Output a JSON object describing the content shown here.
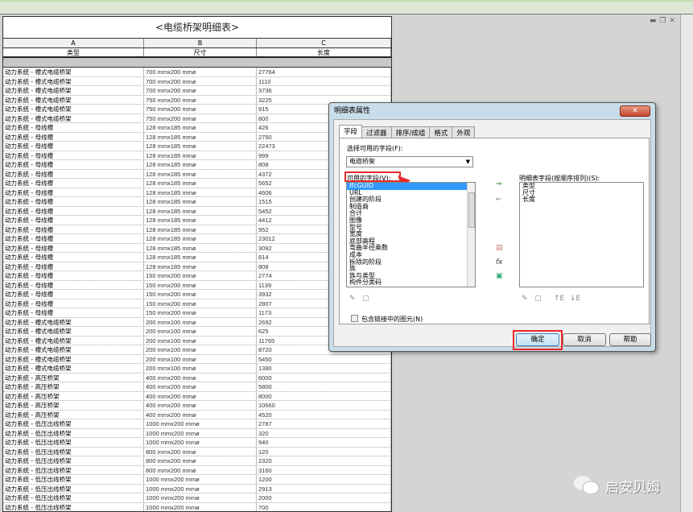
{
  "schedule": {
    "title": "<电缆桥架明细表>",
    "col_letters": [
      "A",
      "B",
      "C"
    ],
    "col_names": [
      "类型",
      "尺寸",
      "长度"
    ],
    "rows": [
      [
        "动力系统 - 槽式电缆桥架",
        "700 mmx200 mmø",
        "27764"
      ],
      [
        "动力系统 - 槽式电缆桥架",
        "700 mmx200 mmø",
        "1110"
      ],
      [
        "动力系统 - 槽式电缆桥架",
        "700 mmx200 mmø",
        "3736"
      ],
      [
        "动力系统 - 槽式电缆桥架",
        "750 mmx200 mmø",
        "3225"
      ],
      [
        "动力系统 - 槽式电缆桥架",
        "750 mmx200 mmø",
        "915"
      ],
      [
        "动力系统 - 槽式电缆桥架",
        "750 mmx200 mmø",
        "800"
      ],
      [
        "动力系统 - 母线槽",
        "128 mmx185 mmø",
        "426"
      ],
      [
        "动力系统 - 母线槽",
        "128 mmx185 mmø",
        "2750"
      ],
      [
        "动力系统 - 母线槽",
        "128 mmx185 mmø",
        "22473"
      ],
      [
        "动力系统 - 母线槽",
        "128 mmx185 mmø",
        "999"
      ],
      [
        "动力系统 - 母线槽",
        "128 mmx185 mmø",
        "808"
      ],
      [
        "动力系统 - 母线槽",
        "128 mmx185 mmø",
        "4372"
      ],
      [
        "动力系统 - 母线槽",
        "128 mmx185 mmø",
        "5652"
      ],
      [
        "动力系统 - 母线槽",
        "128 mmx185 mmø",
        "4606"
      ],
      [
        "动力系统 - 母线槽",
        "128 mmx185 mmø",
        "1515"
      ],
      [
        "动力系统 - 母线槽",
        "128 mmx185 mmø",
        "5452"
      ],
      [
        "动力系统 - 母线槽",
        "128 mmx185 mmø",
        "4412"
      ],
      [
        "动力系统 - 母线槽",
        "128 mmx185 mmø",
        "952"
      ],
      [
        "动力系统 - 母线槽",
        "128 mmx185 mmø",
        "23012"
      ],
      [
        "动力系统 - 母线槽",
        "128 mmx185 mmø",
        "3092"
      ],
      [
        "动力系统 - 母线槽",
        "128 mmx185 mmø",
        "814"
      ],
      [
        "动力系统 - 母线槽",
        "128 mmx185 mmø",
        "808"
      ],
      [
        "动力系统 - 母线槽",
        "150 mmx200 mmø",
        "2774"
      ],
      [
        "动力系统 - 母线槽",
        "150 mmx200 mmø",
        "1139"
      ],
      [
        "动力系统 - 母线槽",
        "150 mmx200 mmø",
        "3932"
      ],
      [
        "动力系统 - 母线槽",
        "150 mmx200 mmø",
        "2807"
      ],
      [
        "动力系统 - 母线槽",
        "150 mmx200 mmø",
        "1173"
      ],
      [
        "动力系统 - 槽式电缆桥架",
        "200 mmx100 mmø",
        "2692"
      ],
      [
        "动力系统 - 槽式电缆桥架",
        "200 mmx100 mmø",
        "625"
      ],
      [
        "动力系统 - 槽式电缆桥架",
        "200 mmx100 mmø",
        "11765"
      ],
      [
        "动力系统 - 槽式电缆桥架",
        "200 mmx100 mmø",
        "8720"
      ],
      [
        "动力系统 - 槽式电缆桥架",
        "200 mmx100 mmø",
        "5450"
      ],
      [
        "动力系统 - 槽式电缆桥架",
        "200 mmx100 mmø",
        "1380"
      ],
      [
        "动力系统 - 高压桥架",
        "400 mmx200 mmø",
        "6000"
      ],
      [
        "动力系统 - 高压桥架",
        "400 mmx200 mmø",
        "5800"
      ],
      [
        "动力系统 - 高压桥架",
        "400 mmx200 mmø",
        "8000"
      ],
      [
        "动力系统 - 高压桥架",
        "400 mmx200 mmø",
        "10660"
      ],
      [
        "动力系统 - 高压桥架",
        "400 mmx200 mmø",
        "4520"
      ],
      [
        "动力系统 - 低压出线桥架",
        "1000 mmx200 mmø",
        "2787"
      ],
      [
        "动力系统 - 低压出线桥架",
        "1000 mmx200 mmø",
        "320"
      ],
      [
        "动力系统 - 低压出线桥架",
        "1000 mmx200 mmø",
        "940"
      ],
      [
        "动力系统 - 低压出线桥架",
        "800 mmx200 mmø",
        "120"
      ],
      [
        "动力系统 - 低压出线桥架",
        "800 mmx200 mmø",
        "2320"
      ],
      [
        "动力系统 - 低压出线桥架",
        "800 mmx200 mmø",
        "3160"
      ],
      [
        "动力系统 - 低压出线桥架",
        "1000 mmx200 mmø",
        "1200"
      ],
      [
        "动力系统 - 低压出线桥架",
        "1000 mmx200 mmø",
        "2913"
      ],
      [
        "动力系统 - 低压出线桥架",
        "1000 mmx200 mmø",
        "2000"
      ],
      [
        "动力系统 - 低压出线桥架",
        "1000 mmx200 mmø",
        "700"
      ]
    ]
  },
  "dialog": {
    "title": "明细表属性",
    "close": "✕",
    "tabs": [
      "字段",
      "过滤器",
      "排序/成组",
      "格式",
      "外观"
    ],
    "select_label": "选择可用的字段(F):",
    "select_value": "电缆桥架",
    "available_label": "可用的字段(V):",
    "available": [
      "IfcGUID",
      "URL",
      "创建的阶段",
      "制造商",
      "合计",
      "图像",
      "型号",
      "宽度",
      "底部高程",
      "弯曲半径乘数",
      "成本",
      "拆除的阶段",
      "族",
      "族与类型",
      "构件分类码"
    ],
    "scheduled_label": "明细表字段(按顺序排列)(S):",
    "scheduled": [
      "类型",
      "尺寸",
      "长度"
    ],
    "include_links": "包含链接中的图元(N)",
    "ok": "确定",
    "cancel": "取消",
    "help": "帮助"
  },
  "watermark": "启安贝姆"
}
